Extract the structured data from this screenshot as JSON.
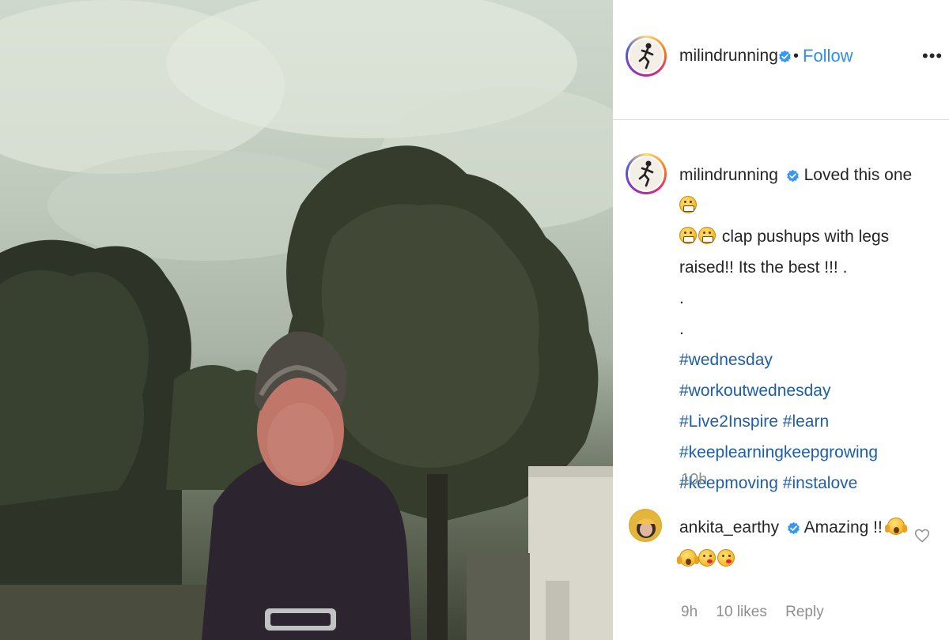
{
  "post": {
    "username": "milindrunning",
    "follow_label": "Follow",
    "separator": "•",
    "more_label": "•••"
  },
  "caption": {
    "username": "milindrunning",
    "text_part1": "Loved this one",
    "text_part2": "clap pushups with legs raised!! Its the best !!! .",
    "dot1": ".",
    "dot2": ".",
    "hashtags": [
      "#wednesday",
      "#workoutwednesday",
      "#Live2Inspire",
      "#learn",
      "#keeplearningkeepgrowing",
      "#keepmoving",
      "#instalove"
    ],
    "time": "10h"
  },
  "comment": {
    "username": "ankita_earthy",
    "text": "Amazing !!",
    "time": "9h",
    "likes": "10 likes",
    "reply_label": "Reply"
  },
  "icons": {
    "verified": "verified-badge-icon",
    "more": "more-options-icon",
    "heart": "heart-icon"
  },
  "colors": {
    "follow": "#2d8fe6",
    "hashtag": "#1f5ea8",
    "verified": "#3897f0",
    "muted": "#8e8e8e"
  }
}
